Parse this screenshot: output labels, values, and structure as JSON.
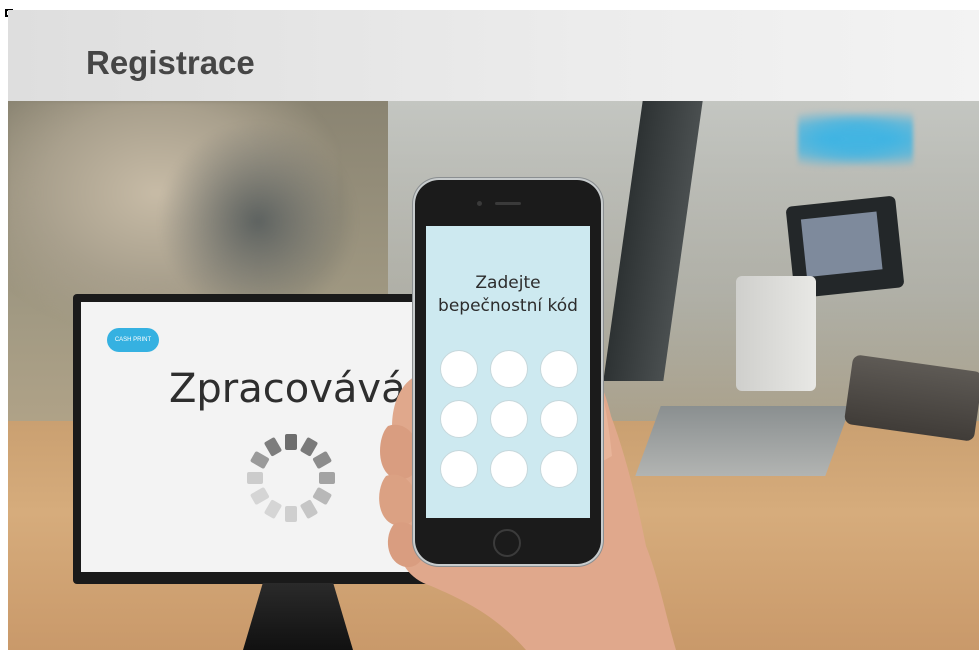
{
  "header": {
    "title": "Registrace"
  },
  "monitor": {
    "logo_text": "CASH PRINT",
    "status_text": "Zpracovává se"
  },
  "phone": {
    "prompt_line1": "Zadejte",
    "prompt_line2": "bepečnostní kód",
    "keypad_buttons": 9
  },
  "colors": {
    "header_text": "#464646",
    "phone_screen": "#cde9f0",
    "brand_blue": "#35b1e1",
    "keypad_button": "#ffffff"
  },
  "icons": [
    "loading-spinner-icon"
  ]
}
